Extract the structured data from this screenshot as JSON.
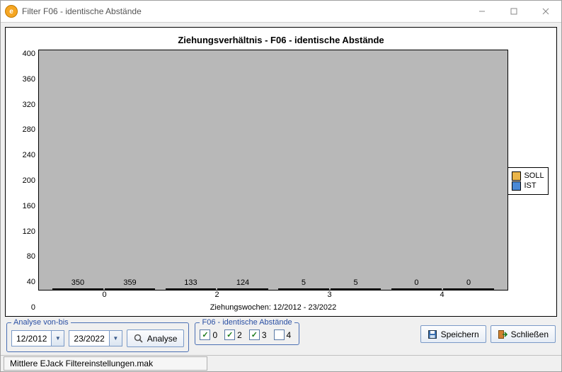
{
  "window": {
    "title": "Filter F06 - identische Abstände"
  },
  "chart_data": {
    "type": "bar",
    "title": "Ziehungsverhältnis  - F06 - identische Abstände",
    "subtitle": "Ziehungswochen: 12/2012  - 23/2022",
    "categories": [
      "0",
      "2",
      "3",
      "4"
    ],
    "series": [
      {
        "name": "SOLL",
        "values": [
          350,
          133,
          5,
          0
        ]
      },
      {
        "name": "IST",
        "values": [
          359,
          124,
          5,
          0
        ]
      }
    ],
    "ylim": [
      0,
      400
    ],
    "ystep": 40,
    "yticks": [
      "400",
      "360",
      "320",
      "280",
      "240",
      "200",
      "160",
      "120",
      "80",
      "40",
      "0"
    ]
  },
  "legend": {
    "soll": "SOLL",
    "ist": "IST"
  },
  "analyse": {
    "legend": "Analyse von-bis",
    "from": "12/2012",
    "to": "23/2022",
    "button": "Analyse"
  },
  "filters": {
    "legend": "F06 - identische Abstände",
    "items": [
      {
        "label": "0",
        "checked": true
      },
      {
        "label": "2",
        "checked": true
      },
      {
        "label": "3",
        "checked": true
      },
      {
        "label": "4",
        "checked": false
      }
    ]
  },
  "buttons": {
    "save": "Speichern",
    "close": "Schließen"
  },
  "status": {
    "file": "Mittlere EJack Filtereinstellungen.mak"
  }
}
